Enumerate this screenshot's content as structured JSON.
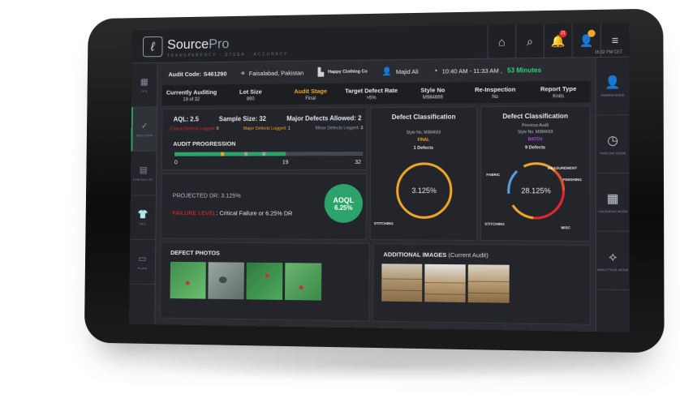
{
  "app": {
    "brand_main": "Source",
    "brand_sub": "Pro",
    "tagline": "TRANSPARENCY · STEER · ACCURACY",
    "time": "15:32 PM CET"
  },
  "header": {
    "audit_code_label": "Audit Code:",
    "audit_code": "S461290",
    "location": "Faisalabad, Pakistan",
    "vendor": "Happy Clothing Co",
    "auditor": "Majid Ali",
    "time_range": "10:40 AM - 11:33 AM ,",
    "duration": "53 Minutes",
    "badge_red": "21",
    "badge_yellow": ""
  },
  "summary": [
    {
      "h": "Currently Auditing",
      "v": "19 of 32"
    },
    {
      "h": "Lot Size",
      "v": "860"
    },
    {
      "h": "Audit Stage",
      "v": "Final"
    },
    {
      "h": "Target Defect Rate",
      "v": ">5%"
    },
    {
      "h": "Style No",
      "v": "M984669"
    },
    {
      "h": "Re-Inspection",
      "v": "No"
    },
    {
      "h": "Report Type",
      "v": "Knits"
    }
  ],
  "aql": {
    "aql": "AQL: 2.5",
    "sample": "Sample Size: 32",
    "major_allowed": "Major Defects Allowed: 2",
    "critical_logged_label": "Critical Defects Logged:",
    "critical_logged": "0",
    "major_logged_label": "Major Defects Logged:",
    "major_logged": "1",
    "minor_logged_label": "Minor Defects Logged:",
    "minor_logged": "3"
  },
  "progression": {
    "title": "AUDIT PROGRESSION",
    "start": "0",
    "current": "19",
    "end": "32",
    "current_value": 19,
    "max_value": 32,
    "markers": [
      8,
      12,
      15
    ]
  },
  "projection": {
    "projected": "PROJECTED DR: 3.125%",
    "failure_label": "FAILURE LEVEL",
    "failure_text": ": Critical Failure or 6.25% DR",
    "aoql_title": "AOQL",
    "aoql_value": "6.25%"
  },
  "defects_current": {
    "title": "Defect Classification",
    "style": "Style No. M984669",
    "stage": "FINAL",
    "count": "1 Defects",
    "value": "3.125%",
    "labels": [
      "STITCHING"
    ]
  },
  "defects_previous": {
    "title": "Defect Classification",
    "subtitle": "Previous Audit",
    "style": "Style No. M984669",
    "stage": "BATCH",
    "count": "9 Defects",
    "value": "28.125%",
    "labels": [
      "MEASUREMENT",
      "FABRIC",
      "FINISHING",
      "STITCHING",
      "MISC"
    ]
  },
  "photos": {
    "title": "DEFECT PHOTOS"
  },
  "images": {
    "title": "ADDITIONAL IMAGES",
    "subtitle": "(Current Audit)"
  },
  "leftnav": [
    "TFS",
    "SECTION",
    "CHECKLIST",
    "TEC",
    "PLAN"
  ],
  "rightnav": [
    {
      "label": "SWARM MODE"
    },
    {
      "label": "TIMELINE MODE"
    },
    {
      "label": "CALENDAR MODE"
    },
    {
      "label": "ANALYTICAL MODE"
    }
  ],
  "colors": {
    "accent": "#2ba36a",
    "critical": "#e0282e",
    "major": "#f0a62b",
    "ring": "#f0a62b"
  }
}
